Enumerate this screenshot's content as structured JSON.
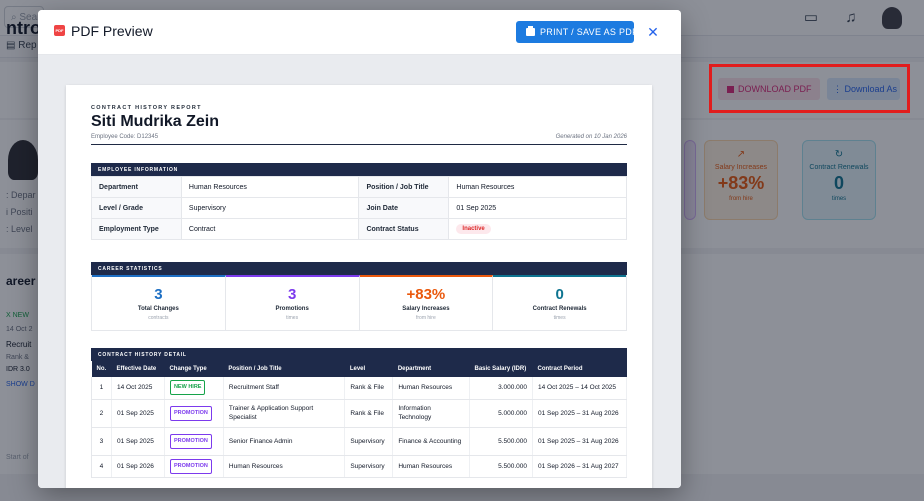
{
  "background": {
    "search_placeholder": "Sear",
    "tab_label": "Rep",
    "page_title": "ntro",
    "download_pdf_label": "DOWNLOAD PDF",
    "download_as_label": "Download As",
    "side_lines": [
      ": Depar",
      "i Positi",
      ": Level"
    ],
    "stat_salary": {
      "label": "Salary Increases",
      "value": "+83%",
      "sub": "from hire"
    },
    "stat_renewal": {
      "label": "Contract Renewals",
      "value": "0",
      "sub": "times"
    },
    "career_title": "areer",
    "career_lines": [
      "X NEW",
      "14 Oct 2",
      "Recruit",
      "Rank &",
      "IDR 3.0",
      "SHOW D"
    ],
    "start_text": "Start of"
  },
  "modal": {
    "title": "PDF Preview",
    "badge_text": "PDF",
    "print_label": "PRINT / SAVE AS PDF",
    "close_label": "✕"
  },
  "report": {
    "label": "CONTRACT HISTORY REPORT",
    "name": "Siti Mudrika Zein",
    "employee_code": "Employee Code: D12345",
    "generated": "Generated on 10 Jan 2026",
    "info_title": "EMPLOYEE INFORMATION",
    "info": {
      "department_label": "Department",
      "department": "Human Resources",
      "position_label": "Position / Job Title",
      "position": "Human Resources",
      "level_label": "Level / Grade",
      "level": "Supervisory",
      "join_label": "Join Date",
      "join": "01 Sep 2025",
      "type_label": "Employment Type",
      "type": "Contract",
      "status_label": "Contract Status",
      "status": "Inactive"
    },
    "stats_title": "CAREER STATISTICS",
    "stats": [
      {
        "value": "3",
        "label": "Total Changes",
        "sub": "contracts",
        "color": "#1d6fc4"
      },
      {
        "value": "3",
        "label": "Promotions",
        "sub": "times",
        "color": "#7c3aed"
      },
      {
        "value": "+83%",
        "label": "Salary Increases",
        "sub": "from hire",
        "color": "#ea580c"
      },
      {
        "value": "0",
        "label": "Contract Renewals",
        "sub": "times",
        "color": "#0e7490"
      }
    ],
    "history_title": "CONTRACT HISTORY DETAIL",
    "history_columns": [
      "No.",
      "Effective Date",
      "Change Type",
      "Position / Job Title",
      "Level",
      "Department",
      "Basic Salary (IDR)",
      "Contract Period"
    ],
    "history_rows": [
      {
        "no": "1",
        "date": "14 Oct 2025",
        "type": "NEW HIRE",
        "position": "Recruitment Staff",
        "level": "Rank & File",
        "department": "Human Resources",
        "salary": "3.000.000",
        "period": "14 Oct 2025 – 14 Oct 2025"
      },
      {
        "no": "2",
        "date": "01 Sep 2025",
        "type": "PROMOTION",
        "position": "Trainer & Application Support Specialist",
        "level": "Rank & File",
        "department": "Information Technology",
        "salary": "5.000.000",
        "period": "01 Sep 2025 – 31 Aug 2026"
      },
      {
        "no": "3",
        "date": "01 Sep 2025",
        "type": "PROMOTION",
        "position": "Senior Finance Admin",
        "level": "Supervisory",
        "department": "Finance & Accounting",
        "salary": "5.500.000",
        "period": "01 Sep 2025 – 31 Aug 2026"
      },
      {
        "no": "4",
        "date": "01 Sep 2026",
        "type": "PROMOTION",
        "position": "Human Resources",
        "level": "Supervisory",
        "department": "Human Resources",
        "salary": "5.500.000",
        "period": "01 Sep 2026 – 31 Aug 2027"
      }
    ],
    "badge_colors": {
      "NEW HIRE": "#16a34a",
      "PROMOTION": "#7c3aed"
    }
  }
}
